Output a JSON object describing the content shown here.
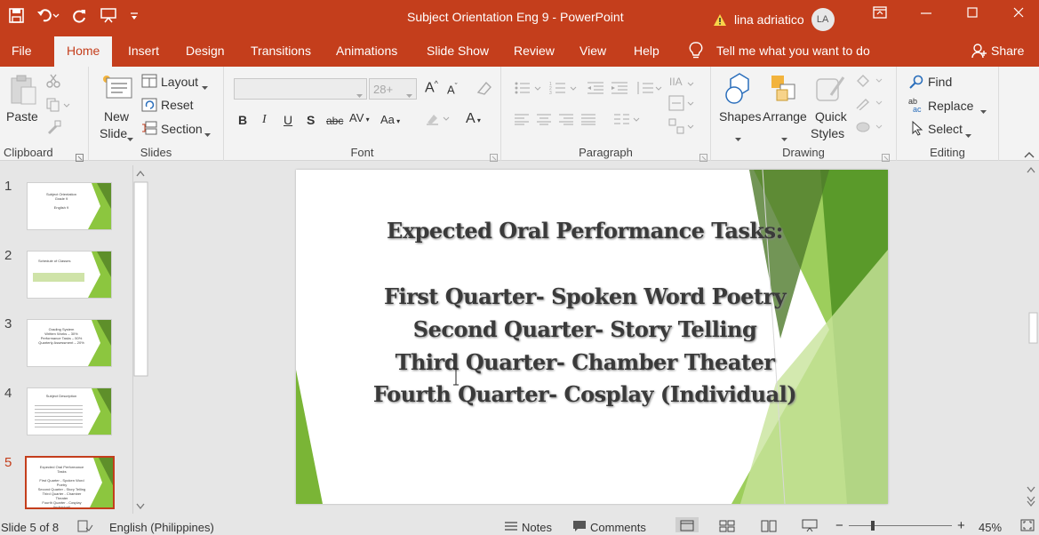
{
  "app": {
    "title": "Subject Orientation Eng 9  -  PowerPoint",
    "user_name": "lina adriatico",
    "user_initials": "LA",
    "colors": {
      "accent": "#c43e1c",
      "slide_green": "#7ab536"
    }
  },
  "tabs": [
    "File",
    "Home",
    "Insert",
    "Design",
    "Transitions",
    "Animations",
    "Slide Show",
    "Review",
    "View",
    "Help"
  ],
  "tell_me": "Tell me what you want to do",
  "share": "Share",
  "ribbon": {
    "clipboard": {
      "label": "Clipboard",
      "paste": "Paste"
    },
    "slides": {
      "label": "Slides",
      "new_slide_1": "New",
      "new_slide_2": "Slide",
      "layout": "Layout",
      "reset": "Reset",
      "section": "Section"
    },
    "font": {
      "label": "Font",
      "size": "28+"
    },
    "paragraph": {
      "label": "Paragraph"
    },
    "drawing": {
      "label": "Drawing",
      "shapes": "Shapes",
      "arrange": "Arrange",
      "quick_1": "Quick",
      "quick_2": "Styles"
    },
    "editing": {
      "label": "Editing",
      "find": "Find",
      "replace": "Replace",
      "select": "Select"
    }
  },
  "thumbnails": [
    {
      "num": "1",
      "lines": [
        "Subject Orientation",
        "Grade 9",
        "English 9"
      ]
    },
    {
      "num": "2",
      "lines": [
        "Schedule of Classes"
      ]
    },
    {
      "num": "3",
      "lines": [
        "Grading System",
        "Written Works – 30%",
        "Performance Tasks – 50%",
        "Quarterly Assessment – 20%"
      ]
    },
    {
      "num": "4",
      "lines": [
        "Subject Description"
      ]
    },
    {
      "num": "5",
      "lines": [
        "Expected Oral Performance Tasks",
        "First Quarter - Spoken Word Poetry",
        "Second Quarter - Story Telling",
        "Third Quarter - Chamber Theater",
        "Fourth Quarter - Cosplay (Individual)"
      ]
    }
  ],
  "slide": {
    "heading": "Expected Oral Performance Tasks:",
    "lines": [
      "First Quarter-  Spoken Word Poetry",
      "Second Quarter- Story Telling",
      "Third Quarter- Chamber Theater",
      "Fourth Quarter- Cosplay (Individual)"
    ]
  },
  "status": {
    "slide_of": "Slide 5 of 8",
    "language": "English (Philippines)",
    "notes": "Notes",
    "comments": "Comments",
    "zoom": "45%"
  }
}
